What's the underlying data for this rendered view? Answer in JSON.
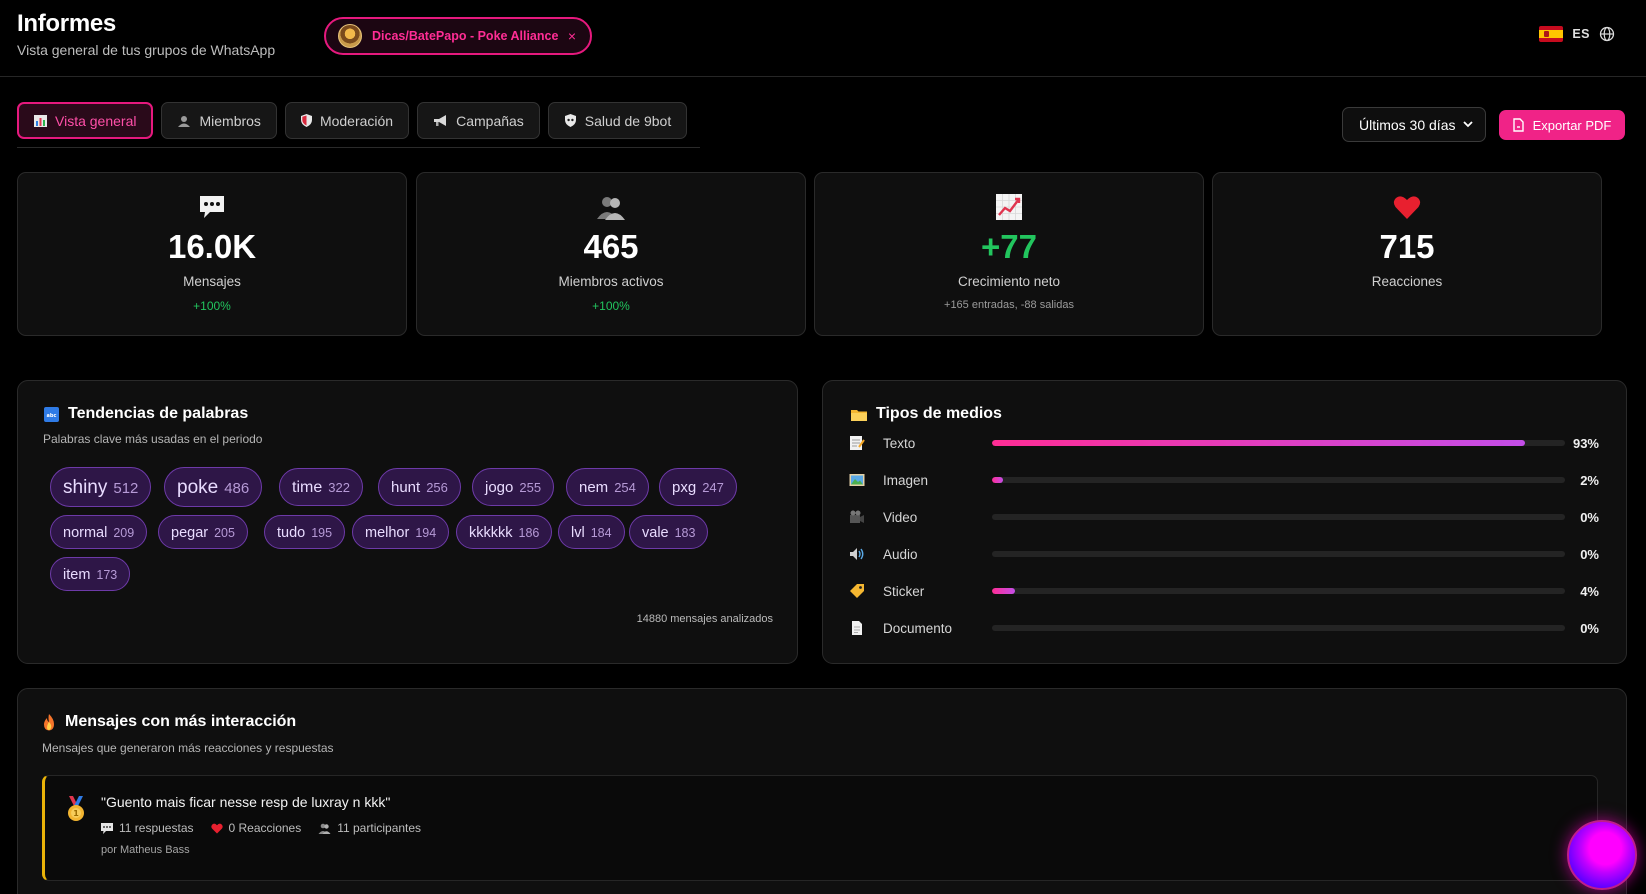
{
  "header": {
    "title": "Informes",
    "subtitle": "Vista general de tus grupos de WhatsApp",
    "group_filter": {
      "name": "Dicas/BatePapo - Poke Alliance",
      "close": "×"
    },
    "language": "ES"
  },
  "tabs": [
    {
      "label": "Vista general",
      "icon": "bar-chart-icon",
      "active": true
    },
    {
      "label": "Miembros",
      "icon": "users-icon",
      "active": false
    },
    {
      "label": "Moderación",
      "icon": "shield-icon",
      "active": false
    },
    {
      "label": "Campañas",
      "icon": "megaphone-icon",
      "active": false
    },
    {
      "label": "Salud de 9bot",
      "icon": "bot-health-icon",
      "active": false
    }
  ],
  "toolbar": {
    "range_label": "Últimos 30 días",
    "export_label": "Exportar PDF"
  },
  "stats": [
    {
      "icon": "speech-bubble-icon",
      "value": "16.0K",
      "label": "Mensajes",
      "change": "+100%"
    },
    {
      "icon": "people-icon",
      "value": "465",
      "label": "Miembros activos",
      "change": "+100%"
    },
    {
      "icon": "chart-up-icon",
      "value": "+77",
      "label": "Crecimiento neto",
      "sub": "+165 entradas, -88 salidas"
    },
    {
      "icon": "heart-icon",
      "value": "715",
      "label": "Reacciones"
    }
  ],
  "word_trends": {
    "title": "Tendencias de palabras",
    "subtitle": "Palabras clave más usadas en el periodo",
    "analyzed": "14880 mensajes analizados",
    "words": [
      {
        "w": "shiny",
        "c": "512"
      },
      {
        "w": "poke",
        "c": "486"
      },
      {
        "w": "time",
        "c": "322"
      },
      {
        "w": "hunt",
        "c": "256"
      },
      {
        "w": "jogo",
        "c": "255"
      },
      {
        "w": "nem",
        "c": "254"
      },
      {
        "w": "pxg",
        "c": "247"
      },
      {
        "w": "normal",
        "c": "209"
      },
      {
        "w": "pegar",
        "c": "205"
      },
      {
        "w": "tudo",
        "c": "195"
      },
      {
        "w": "melhor",
        "c": "194"
      },
      {
        "w": "kkkkkk",
        "c": "186"
      },
      {
        "w": "lvl",
        "c": "184"
      },
      {
        "w": "vale",
        "c": "183"
      },
      {
        "w": "item",
        "c": "173"
      }
    ]
  },
  "media_types": {
    "title": "Tipos de medios",
    "items": [
      {
        "name": "Texto",
        "icon": "memo-icon",
        "pct_label": "93%",
        "pct": 93
      },
      {
        "name": "Imagen",
        "icon": "picture-icon",
        "pct_label": "2%",
        "pct": 2
      },
      {
        "name": "Video",
        "icon": "video-camera-icon",
        "pct_label": "0%",
        "pct": 0
      },
      {
        "name": "Audio",
        "icon": "speaker-icon",
        "pct_label": "0%",
        "pct": 0
      },
      {
        "name": "Sticker",
        "icon": "label-icon",
        "pct_label": "4%",
        "pct": 4
      },
      {
        "name": "Documento",
        "icon": "document-icon",
        "pct_label": "0%",
        "pct": 0
      }
    ]
  },
  "top_messages": {
    "title": "Mensajes con más interacción",
    "subtitle": "Mensajes que generaron más reacciones y respuestas",
    "items": [
      {
        "text": "\"Guento mais ficar nesse resp de luxray n kkk\"",
        "replies": "11 respuestas",
        "reactions": "0 Reacciones",
        "participants": "11 participantes",
        "author": "por Matheus Bass"
      }
    ]
  },
  "colors": {
    "accent": "#f02387",
    "positive": "#22c55e",
    "panel": "#0f0f0f"
  }
}
